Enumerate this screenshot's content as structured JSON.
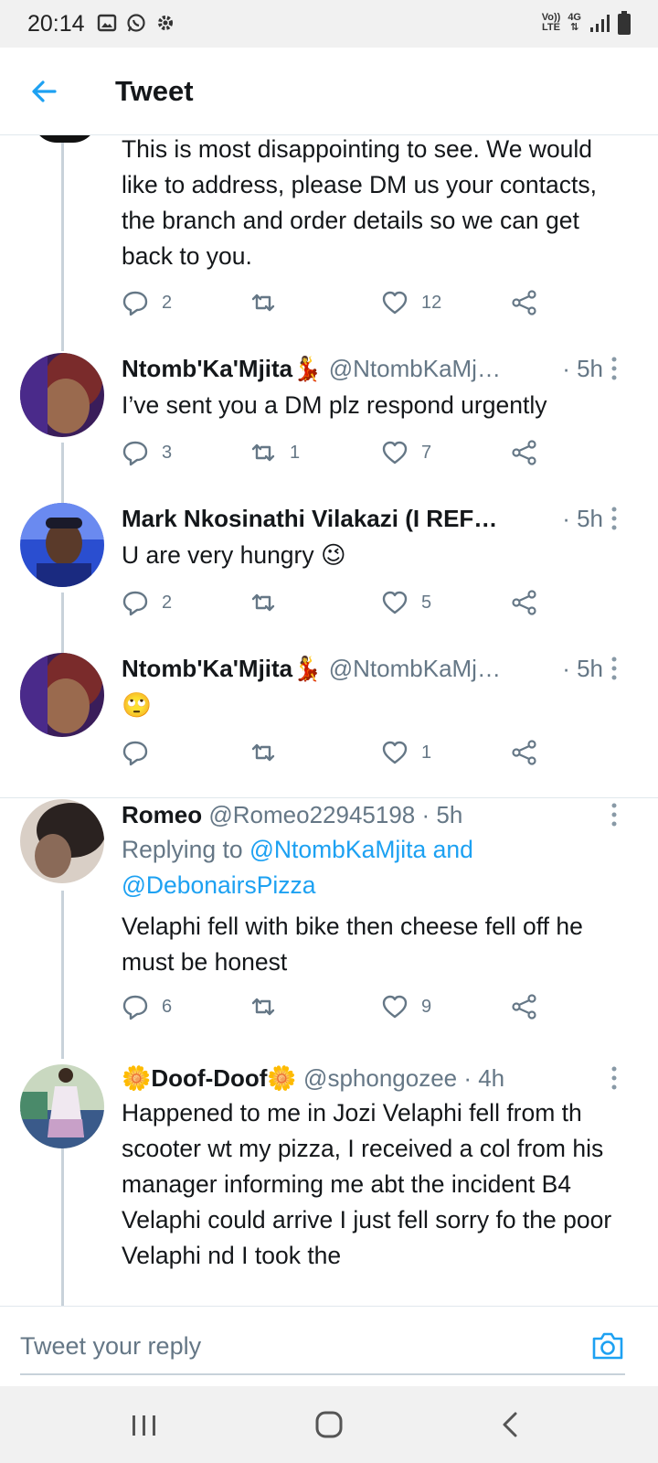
{
  "status_bar": {
    "time": "20:14",
    "network_top": "Vo))",
    "network_bottom": "LTE",
    "data_type": "4G"
  },
  "header": {
    "title": "Tweet"
  },
  "first_tweet": {
    "text": "This is most disappointing to see. We would like to address, please DM us your contacts, the branch and order details so we can get back to you.",
    "replies": "2",
    "retweets": "",
    "likes": "12"
  },
  "tweets": [
    {
      "name": "Ntomb'Ka'Mjita💃",
      "handle": "@NtombKaMj…",
      "time": "· 5h",
      "text": "I’ve sent you a DM plz respond urgently",
      "replies": "3",
      "retweets": "1",
      "likes": "7"
    },
    {
      "name": "Mark Nkosinathi Vilakazi (I REF…",
      "handle": "",
      "time": "· 5h",
      "text": "U are very hungry 😉",
      "replies": "2",
      "retweets": "",
      "likes": "5"
    },
    {
      "name": "Ntomb'Ka'Mjita💃",
      "handle": "@NtombKaMj…",
      "time": "· 5h",
      "text": "🙄",
      "replies": "",
      "retweets": "",
      "likes": "1"
    },
    {
      "name": "Romeo",
      "handle": "@Romeo22945198 · 5h",
      "time": "",
      "replying_prefix": "Replying to ",
      "replying_to": "@NtombKaMjita and @DebonairsPizza",
      "text": "Velaphi fell with bike then cheese fell off he must be honest",
      "replies": "6",
      "retweets": "",
      "likes": "9"
    },
    {
      "name": "🌼Doof-Doof🌼",
      "handle": "@sphongozee · 4h",
      "time": "",
      "text": "Happened to me in Jozi Velaphi fell from th scooter wt my pizza, I received a col from his manager informing me abt the incident B4 Velaphi could arrive I just fell sorry fo the poor Velaphi nd I took the",
      "replies": "",
      "retweets": "",
      "likes": ""
    }
  ],
  "reply_bar": {
    "placeholder": "Tweet your reply"
  },
  "icons": {
    "reply": "reply-icon",
    "retweet": "retweet-icon",
    "like": "heart-icon",
    "share": "share-icon",
    "camera": "camera-icon",
    "back": "back-arrow-icon",
    "more": "more-vertical-icon"
  },
  "colors": {
    "accent": "#1da1f2",
    "text": "#14171a",
    "muted": "#657786",
    "line": "#c8d2da"
  }
}
